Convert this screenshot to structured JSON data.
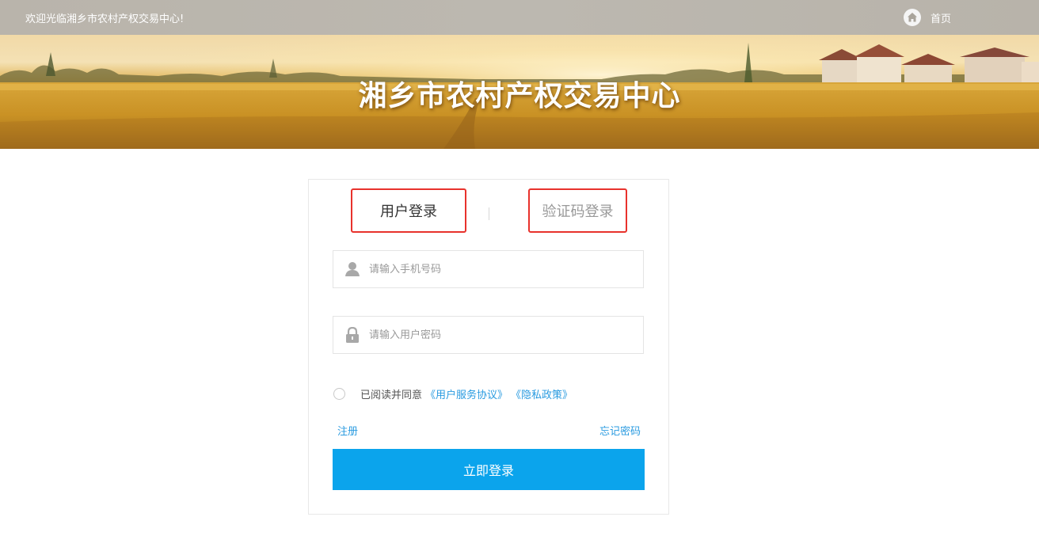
{
  "topbar": {
    "welcome": "欢迎光临湘乡市农村产权交易中心!",
    "home_label": "首页",
    "home_icon": "home-icon"
  },
  "banner": {
    "title": "湘乡市农村产权交易中心"
  },
  "login": {
    "tabs": {
      "user": "用户登录",
      "code": "验证码登录"
    },
    "active_tab": "用户登录",
    "phone": {
      "placeholder": "请输入手机号码",
      "value": "",
      "icon": "user-icon"
    },
    "password": {
      "placeholder": "请输入用户密码",
      "value": "",
      "icon": "lock-icon"
    },
    "agreement": {
      "text": "已阅读并同意",
      "service_link": "《用户服务协议》",
      "privacy_link": "《隐私政策》",
      "checked": false
    },
    "register": "注册",
    "forgot": "忘记密码",
    "submit": "立即登录"
  },
  "colors": {
    "accent": "#0ba4ec",
    "link": "#2a9be0",
    "highlight_border": "#e8322c"
  }
}
